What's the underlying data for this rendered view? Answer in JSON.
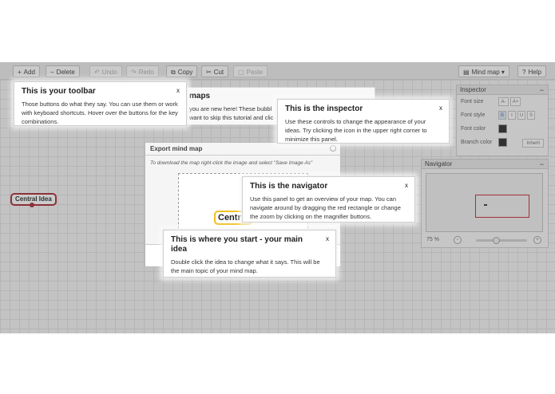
{
  "toolbar": {
    "add": "Add",
    "delete": "Delete",
    "undo": "Undo",
    "redo": "Redo",
    "copy": "Copy",
    "cut": "Cut",
    "paste": "Paste",
    "mindmap_menu": "Mind map",
    "help": "Help"
  },
  "inspector": {
    "title": "Inspector",
    "font_size_label": "Font size",
    "font_size_decrease": "A-",
    "font_size_increase": "A+",
    "font_style_label": "Font style",
    "bold": "B",
    "italic": "I",
    "underline": "U",
    "strike": "S",
    "font_color_label": "Font color",
    "branch_color_label": "Branch color",
    "inherit_button": "Inherit"
  },
  "navigator": {
    "title": "Navigator",
    "zoom_level": "75 %"
  },
  "canvas": {
    "central_idea": "Central Idea"
  },
  "export_dialog": {
    "title": "Export mind map",
    "hint": "To download the map right-click the image and select \"Save Image As\"",
    "preview_text": "Centr"
  },
  "mindmaps_bubble": {
    "title": "maps",
    "line1": "you are new here! These bubbl",
    "line2": "want to skip this tutorial and clic"
  },
  "bubbles": {
    "toolbar": {
      "title": "This is your toolbar",
      "close": "x",
      "body": "Those buttons do what they say. You can use them or work with keyboard shortcuts. Hover over the buttons for the key combinations."
    },
    "inspector": {
      "title": "This is the inspector",
      "close": "x",
      "body": "Use these controls to change the appearance of your ideas. Try clicking the icon in the upper right corner to minimize this panel."
    },
    "navigator": {
      "title": "This is the navigator",
      "close": "x",
      "body": "Use this panel to get an overview of your map. You can navigate around by dragging the red rectangle or change the zoom by clicking on the magnifier buttons."
    },
    "start": {
      "title": "This is where you start - your main idea",
      "close": "x",
      "body": "Double click the idea to change what it says. This will be the main topic of your mind map."
    }
  },
  "colors": {
    "accent_red": "#a0222c",
    "preview_border": "#f0c020"
  }
}
